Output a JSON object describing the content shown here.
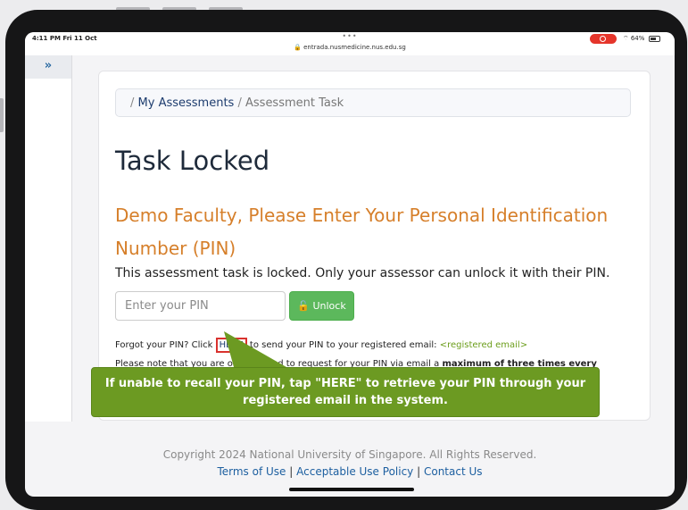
{
  "status_bar": {
    "time": "4:11 PM  Fri 11 Oct",
    "dots": "•••",
    "url": "🔒 entrada.nusmedicine.nus.edu.sg",
    "battery": "64%"
  },
  "sidebar": {
    "toggle_icon": "»"
  },
  "breadcrumb": {
    "separator": "/",
    "link": "My Assessments",
    "current": "Assessment Task"
  },
  "page": {
    "title": "Task Locked",
    "subheading": "Demo Faculty, Please Enter Your Personal Identification Number (PIN)",
    "description": "This assessment task is locked. Only your assessor can unlock it with their PIN."
  },
  "form": {
    "pin_placeholder": "Enter your PIN",
    "pin_value": "",
    "unlock_label": "🔓 Unlock"
  },
  "help": {
    "forgot_prefix": "Forgot your PIN? Click ",
    "here_label": "HERE",
    "forgot_suffix": " to send your PIN to your registered email: ",
    "registered_email": "<registered email>",
    "note_prefix": "Please note that you are only allowed to request for your PIN via email a ",
    "note_bold": "maximum of three times every twenty-four hours",
    "note_suffix": "."
  },
  "tooltip": {
    "text": "If unable to recall your PIN, tap \"HERE\" to retrieve your PIN through your registered email in the system."
  },
  "footer": {
    "copyright": "Copyright 2024 National University of Singapore. All Rights Reserved.",
    "links": [
      "Terms of Use",
      "Acceptable Use Policy",
      "Contact Us"
    ],
    "separator": "|"
  },
  "colors": {
    "accent_orange": "#d67f2a",
    "button_green": "#5cb85c",
    "callout_green": "#6c9a22",
    "highlight_red": "#d9322e"
  }
}
